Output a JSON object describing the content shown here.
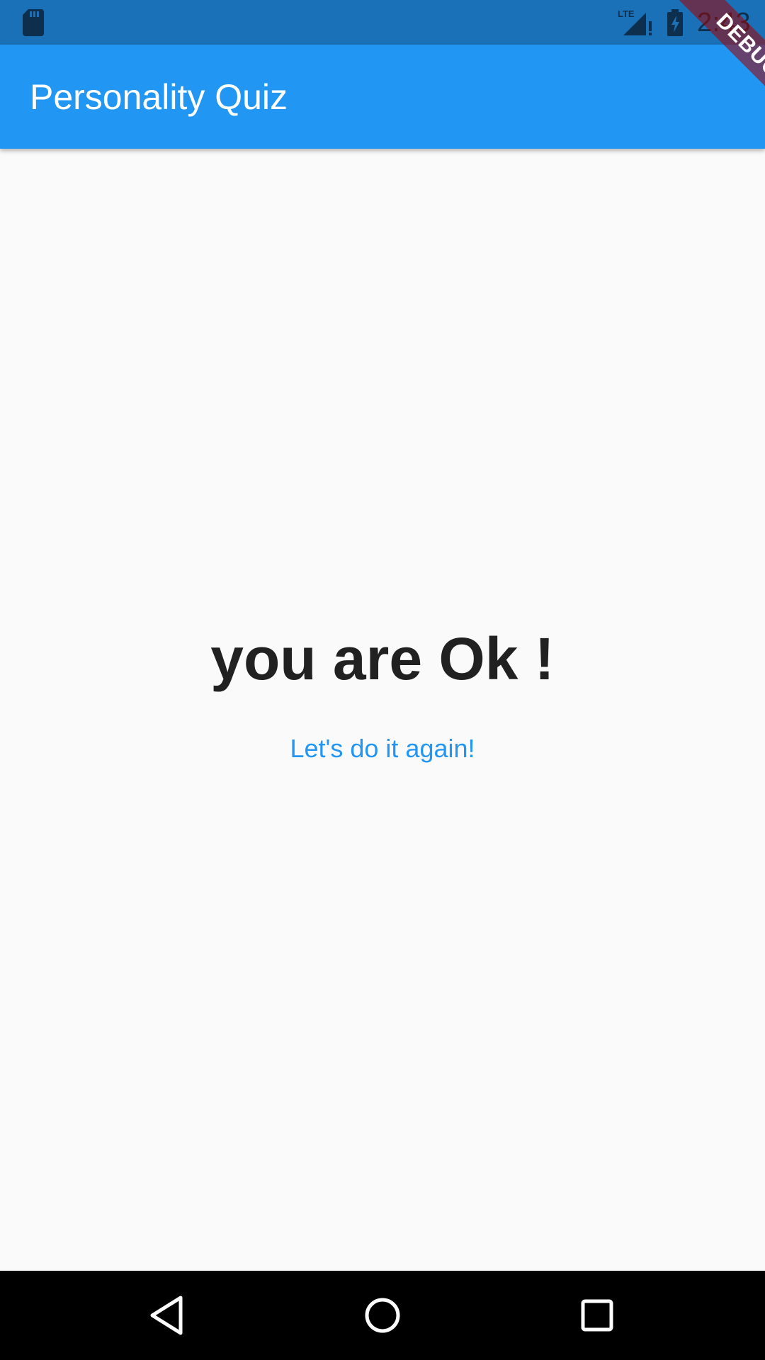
{
  "status_bar": {
    "time": "2:43",
    "icons": [
      "sd-card-icon",
      "lte-signal-icon",
      "battery-charging-icon"
    ]
  },
  "app_bar": {
    "title": "Personality Quiz"
  },
  "debug_banner": {
    "label": "DEBUG"
  },
  "result": {
    "message": "you are Ok !",
    "restart_label": "Let's do it again!"
  },
  "nav_bar": {
    "icons": [
      "back-icon",
      "home-icon",
      "recents-icon"
    ]
  },
  "colors": {
    "status_bar": "#1b71b8",
    "app_bar": "#2196f3",
    "accent": "#2196f3",
    "background": "#fafafa",
    "nav_bar": "#000000"
  }
}
